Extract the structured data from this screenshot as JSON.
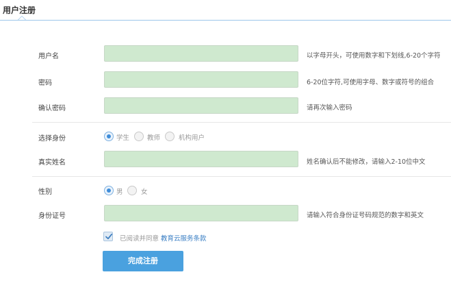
{
  "tab": {
    "title": "用户注册"
  },
  "form": {
    "username": {
      "label": "用户名",
      "value": "",
      "hint": "以字母开头，可使用数字和下划线,6-20个字符"
    },
    "password": {
      "label": "密码",
      "value": "",
      "hint": "6-20位字符,可使用字母、数字或符号的组合"
    },
    "confirm_password": {
      "label": "确认密码",
      "value": "",
      "hint": "请再次输入密码"
    },
    "identity": {
      "label": "选择身份",
      "options": [
        "学生",
        "教师",
        "机构用户"
      ],
      "selected": "学生"
    },
    "real_name": {
      "label": "真实姓名",
      "value": "",
      "hint": "姓名确认后不能修改，请输入2-10位中文"
    },
    "gender": {
      "label": "性别",
      "options": [
        "男",
        "女"
      ],
      "selected": "男"
    },
    "id_number": {
      "label": "身份证号",
      "value": "",
      "hint": "请输入符合身份证号码规范的数字和英文"
    },
    "agreement": {
      "text": "已阅读并同意",
      "link": "教育云服务条款",
      "checked": true
    },
    "submit_label": "完成注册"
  },
  "colors": {
    "accent": "#4aa1df",
    "input_bg": "#cfe9cf",
    "link": "#3b7fc4"
  },
  "icons": [
    "checkmark-icon"
  ]
}
